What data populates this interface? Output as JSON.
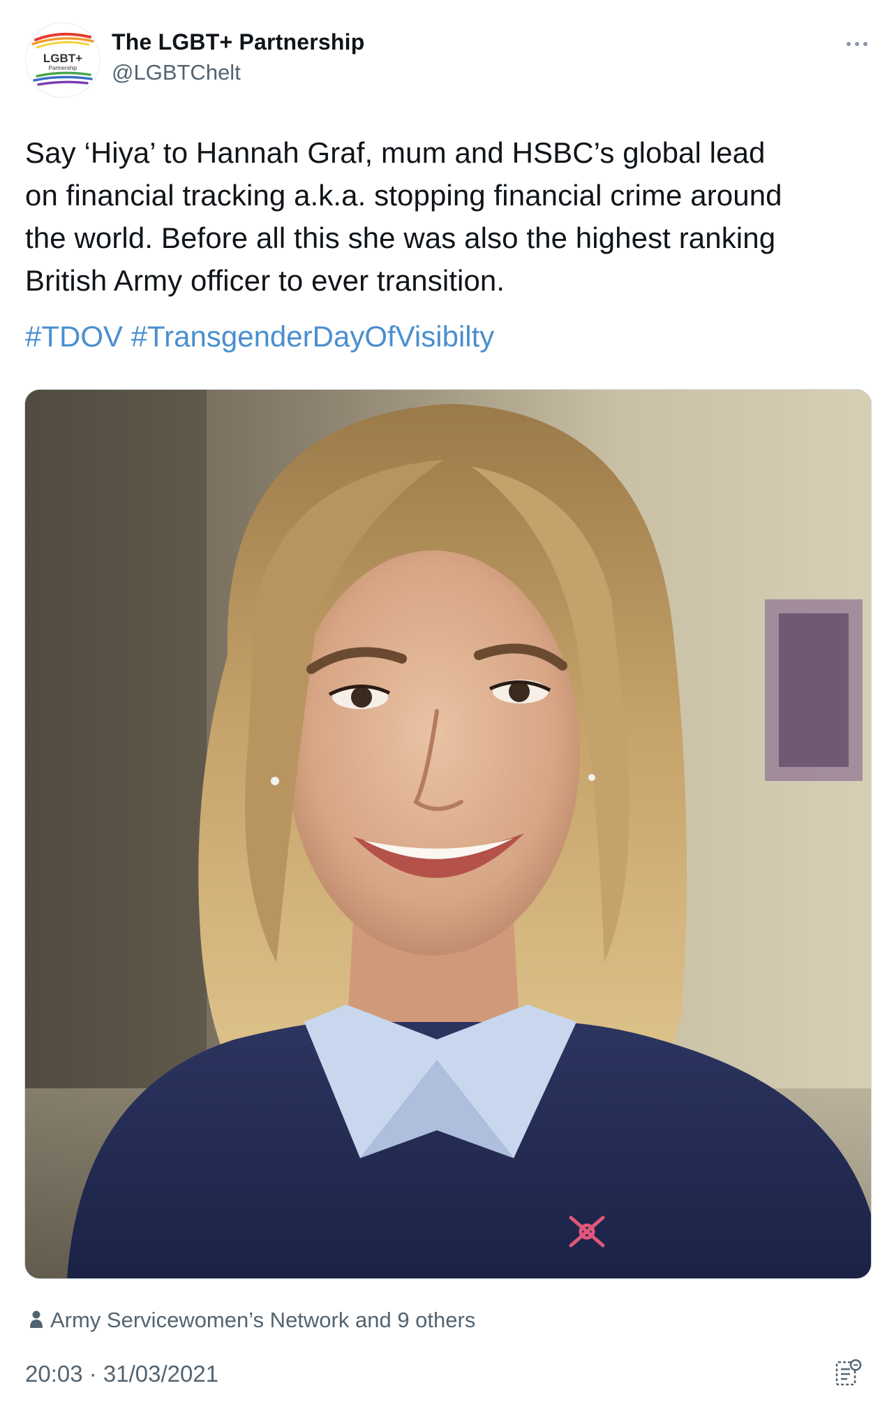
{
  "author": {
    "display_name": "The LGBT+ Partnership",
    "handle": "@LGBTChelt",
    "avatar_logo_text": "LGBT+",
    "avatar_logo_subtext": "Partnership"
  },
  "menu": {
    "more_icon": "more-horizontal-icon"
  },
  "tweet": {
    "lines": [
      "Say ‘Hiya’ to Hannah Graf, mum and HSBC’s global lead",
      "on financial tracking a.k.a. stopping financial crime around",
      "the world. Before all this she was also the highest ranking",
      "British Army officer to ever transition."
    ],
    "hashtags": [
      "#TDOV",
      "#TransgenderDayOfVisibilty"
    ]
  },
  "media": {
    "type": "photo"
  },
  "tagged": {
    "icon": "person-icon",
    "text": "Army Servicewomen’s Network and 9 others"
  },
  "footer": {
    "timestamp": "20:03 · 31/03/2021",
    "analytics_icon": "analytics-icon"
  },
  "colors": {
    "link": "#4a8fd0",
    "secondary_text": "#536471",
    "primary_text": "#0f1419"
  }
}
